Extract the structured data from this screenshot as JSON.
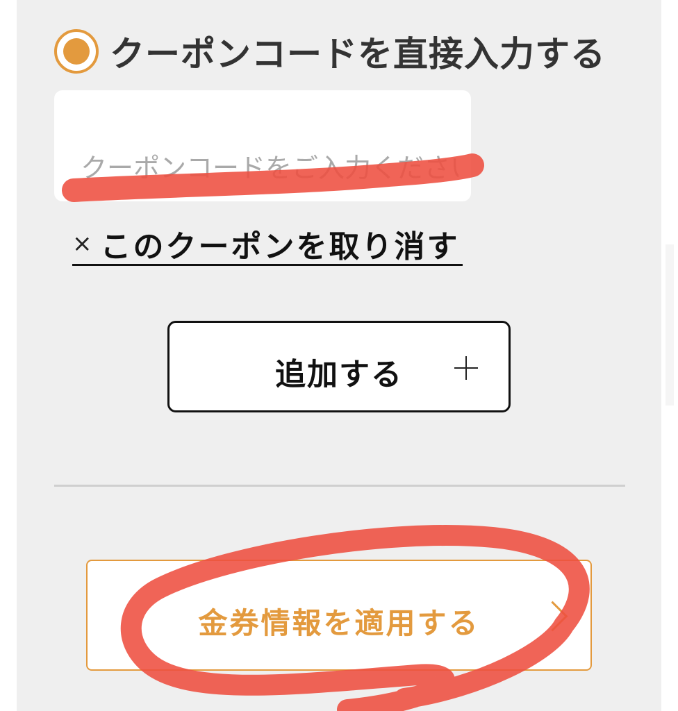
{
  "coupon_section": {
    "option_label": "クーポンコードを直接入力する",
    "input_placeholder": "クーポンコードをご入力ください",
    "input_value": "",
    "cancel_x": "×",
    "cancel_label": "このクーポンを取り消す",
    "add_label": "追加する"
  },
  "footer": {
    "apply_label": "金券情報を適用する"
  },
  "colors": {
    "accent_orange": "#e39a3e",
    "panel_background": "#efefef",
    "marker_red": "#ee4e40"
  },
  "icons": {
    "radio": "radio-selected-icon",
    "cancel": "close-x",
    "add": "plus-icon",
    "apply": "chevron-right-icon"
  }
}
